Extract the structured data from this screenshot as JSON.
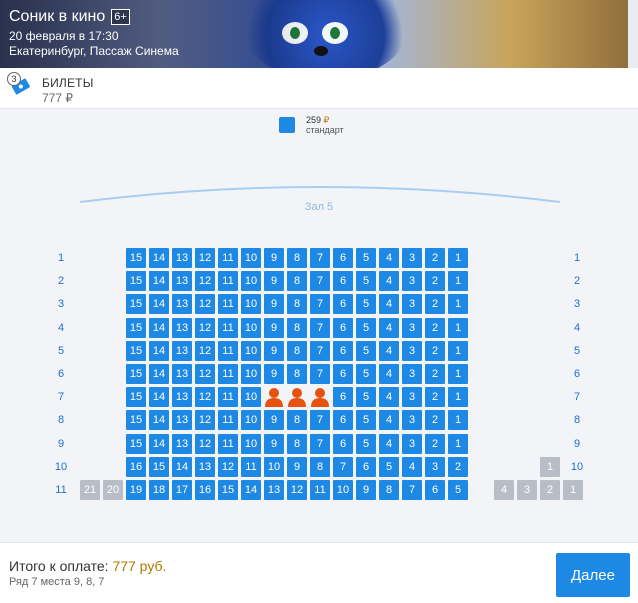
{
  "movie": {
    "title": "Соник в кино",
    "age_rating": "6+",
    "datetime": "20 февраля в 17:30",
    "venue": "Екатеринбург, Пассаж Синема"
  },
  "tickets": {
    "count": "3",
    "label": "БИЛЕТЫ",
    "sum": "777 ₽"
  },
  "legend": {
    "price": "259",
    "currency": "₽",
    "category": "стандарт",
    "color": "#1e88e5"
  },
  "hall": "Зал 5",
  "rows": [
    {
      "label": "1",
      "seats": [
        "15",
        "14",
        "13",
        "12",
        "11",
        "10",
        "9",
        "8",
        "7",
        "6",
        "5",
        "4",
        "3",
        "2",
        "1"
      ]
    },
    {
      "label": "2",
      "seats": [
        "15",
        "14",
        "13",
        "12",
        "11",
        "10",
        "9",
        "8",
        "7",
        "6",
        "5",
        "4",
        "3",
        "2",
        "1"
      ]
    },
    {
      "label": "3",
      "seats": [
        "15",
        "14",
        "13",
        "12",
        "11",
        "10",
        "9",
        "8",
        "7",
        "6",
        "5",
        "4",
        "3",
        "2",
        "1"
      ]
    },
    {
      "label": "4",
      "seats": [
        "15",
        "14",
        "13",
        "12",
        "11",
        "10",
        "9",
        "8",
        "7",
        "6",
        "5",
        "4",
        "3",
        "2",
        "1"
      ]
    },
    {
      "label": "5",
      "seats": [
        "15",
        "14",
        "13",
        "12",
        "11",
        "10",
        "9",
        "8",
        "7",
        "6",
        "5",
        "4",
        "3",
        "2",
        "1"
      ]
    },
    {
      "label": "6",
      "seats": [
        "15",
        "14",
        "13",
        "12",
        "11",
        "10",
        "9",
        "8",
        "7",
        "6",
        "5",
        "4",
        "3",
        "2",
        "1"
      ]
    },
    {
      "label": "7",
      "seats": [
        "15",
        "14",
        "13",
        "12",
        "11",
        "10",
        "9",
        "8",
        "7",
        "6",
        "5",
        "4",
        "3",
        "2",
        "1"
      ],
      "selected": [
        "9",
        "8",
        "7"
      ]
    },
    {
      "label": "8",
      "seats": [
        "15",
        "14",
        "13",
        "12",
        "11",
        "10",
        "9",
        "8",
        "7",
        "6",
        "5",
        "4",
        "3",
        "2",
        "1"
      ]
    },
    {
      "label": "9",
      "seats": [
        "15",
        "14",
        "13",
        "12",
        "11",
        "10",
        "9",
        "8",
        "7",
        "6",
        "5",
        "4",
        "3",
        "2",
        "1"
      ]
    },
    {
      "label": "10",
      "seats": [
        "16",
        "15",
        "14",
        "13",
        "12",
        "11",
        "10",
        "9",
        "8",
        "7",
        "6",
        "5",
        "4",
        "3",
        "2"
      ],
      "taken_right": [
        "1"
      ]
    },
    {
      "label": "11",
      "taken_left": [
        "21",
        "20"
      ],
      "seats": [
        "19",
        "18",
        "17",
        "16",
        "15",
        "14",
        "13",
        "12",
        "11",
        "10",
        "9",
        "8",
        "7",
        "6",
        "5"
      ],
      "taken_right": [
        "4",
        "3",
        "2",
        "1"
      ]
    }
  ],
  "footer": {
    "total_label": "Итого к оплате:",
    "total_amount": "777 руб.",
    "places": "Ряд 7 места 9, 8, 7",
    "next_button": "Далее"
  },
  "colors": {
    "seat_free": "#1e88e5",
    "seat_taken": "#b9bec6",
    "seat_selected": "#e8520f",
    "row_label": "#1e6fd6"
  }
}
